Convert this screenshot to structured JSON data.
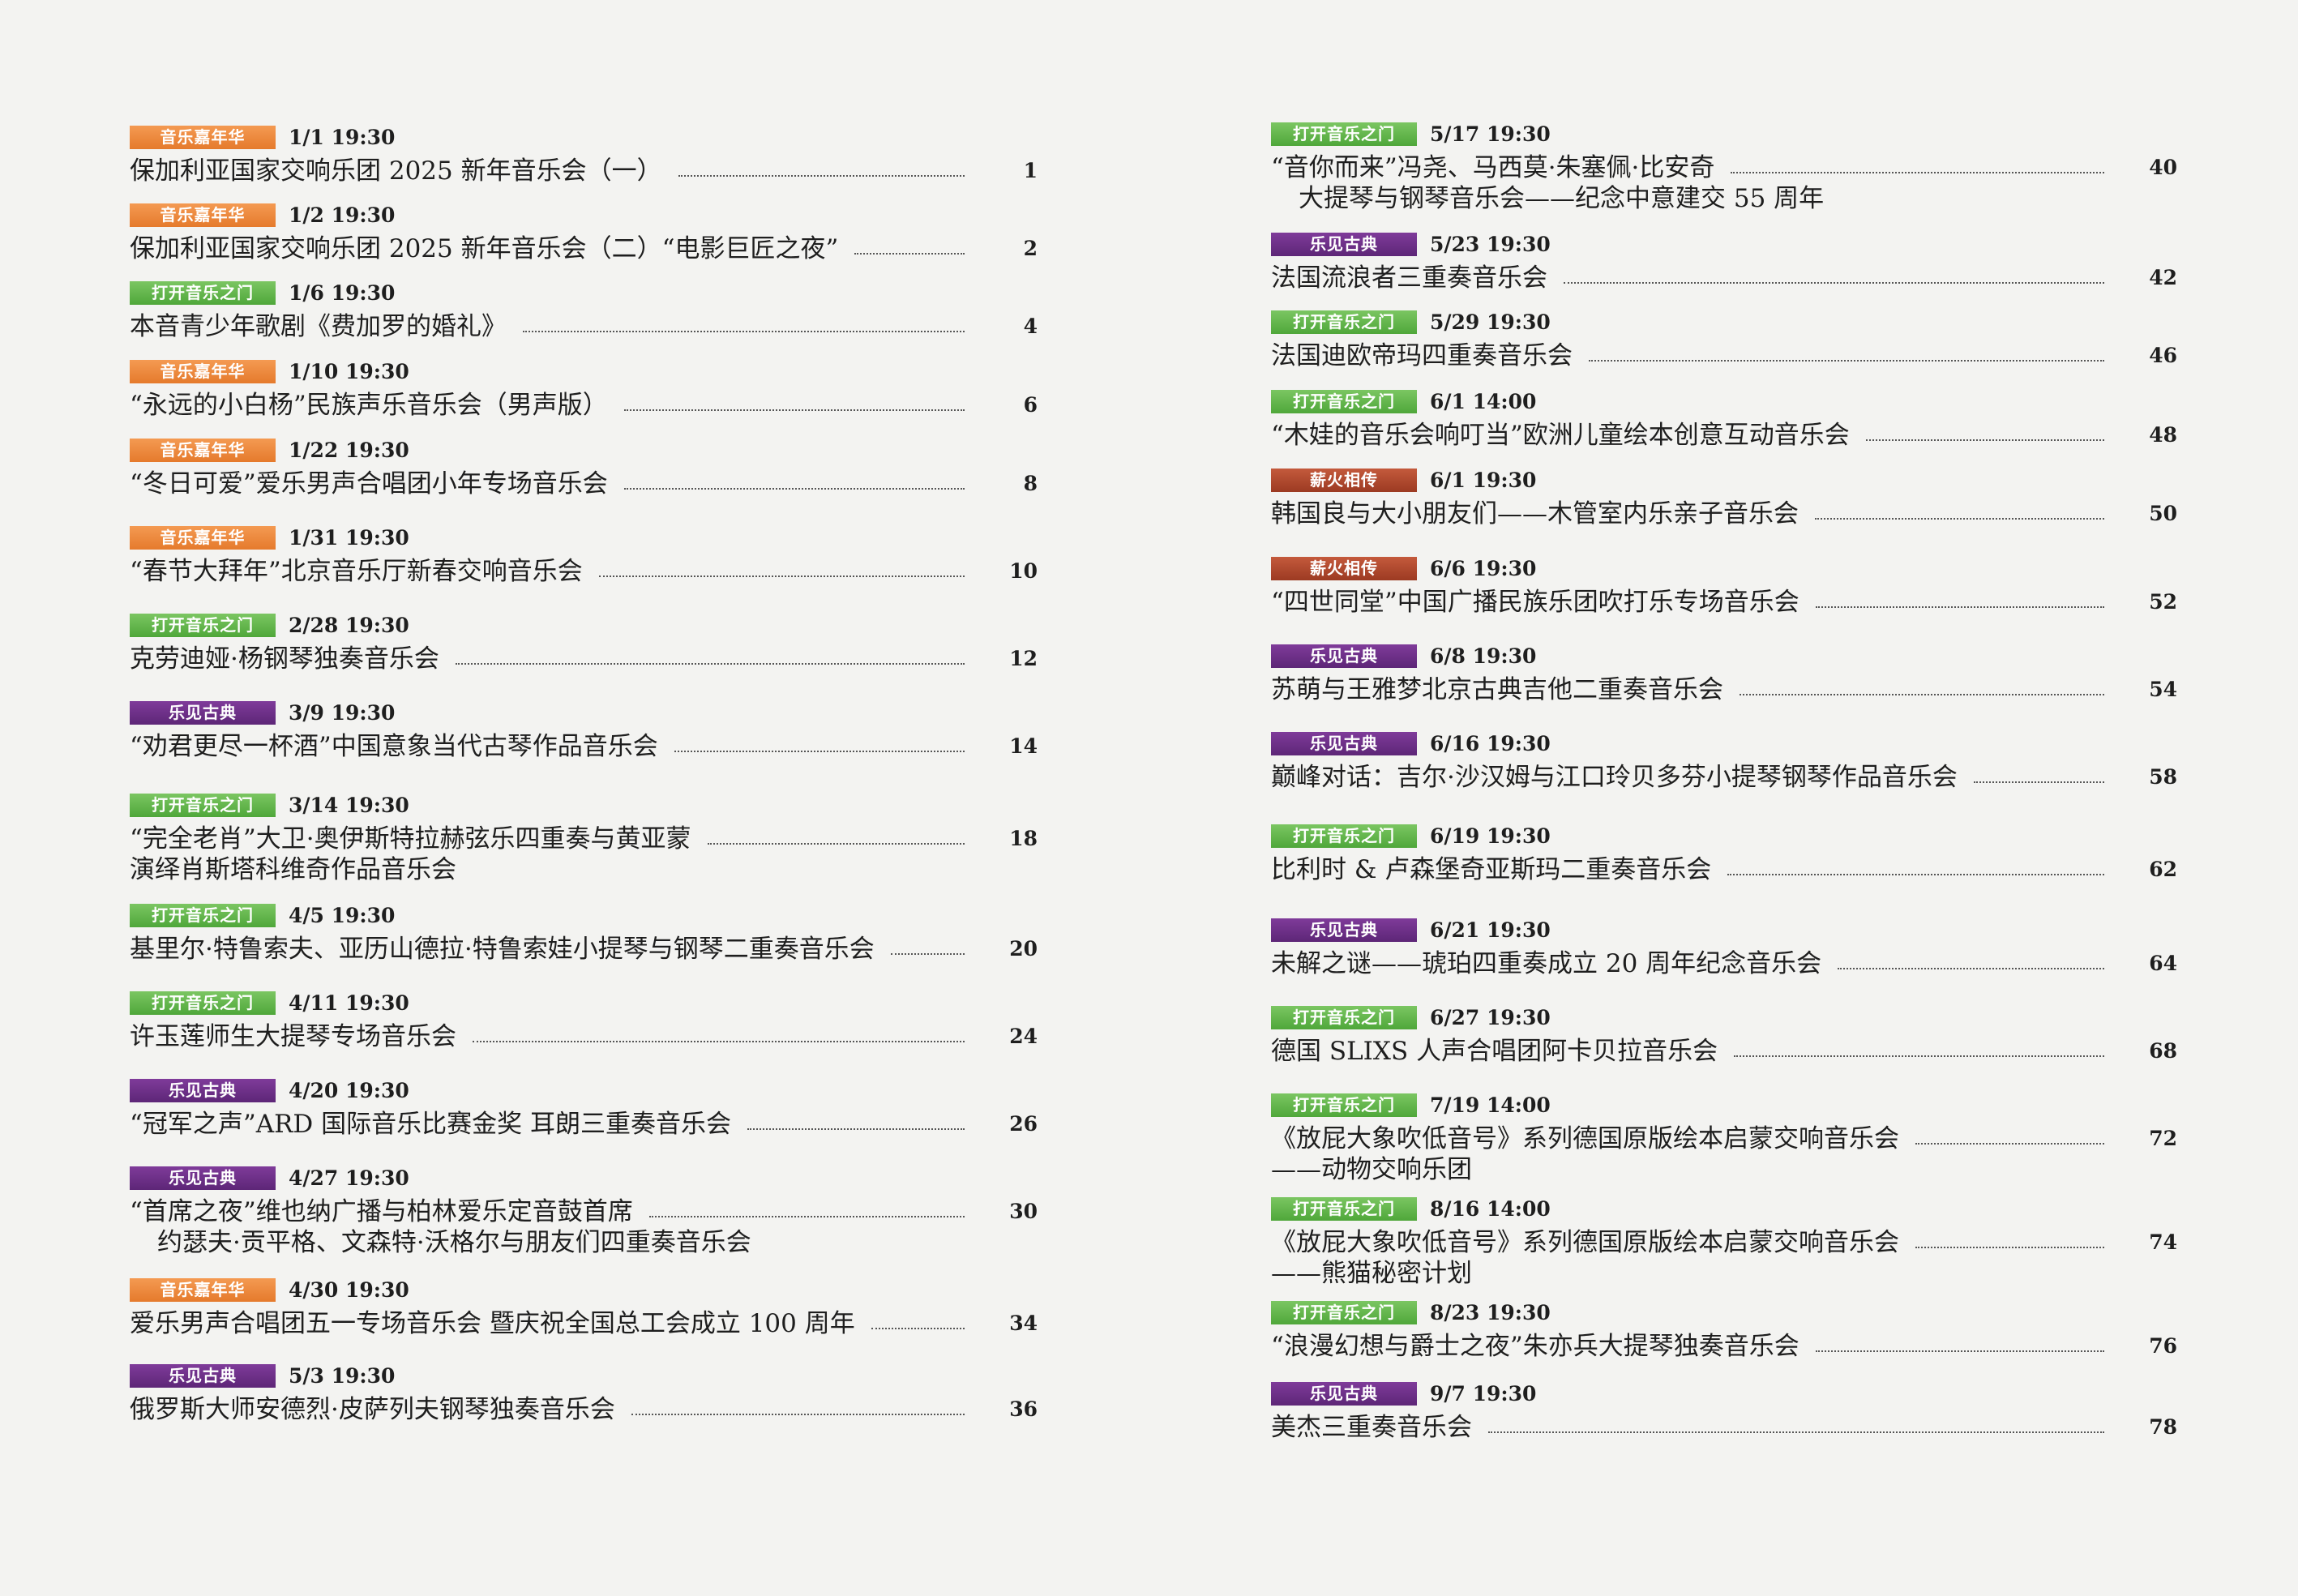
{
  "tags": {
    "music_carnival": "音乐嘉年华",
    "open_door": "打开音乐之门",
    "classics": "乐见古典",
    "heritage": "薪火相传"
  },
  "tag_colors": {
    "orange": "#e57a2c",
    "green": "#4fa73a",
    "purple": "#5d2677",
    "red": "#9c3a22"
  },
  "left": [
    {
      "tag": "音乐嘉年华",
      "date": "1/1 19:30",
      "title": "保加利亚国家交响乐团 2025 新年音乐会（一）",
      "page": "1"
    },
    {
      "tag": "音乐嘉年华",
      "date": "1/2 19:30",
      "title": "保加利亚国家交响乐团 2025 新年音乐会（二）“电影巨匠之夜”",
      "page": "2"
    },
    {
      "tag": "打开音乐之门",
      "date": "1/6 19:30",
      "title": "本音青少年歌剧《费加罗的婚礼》",
      "page": "4"
    },
    {
      "tag": "音乐嘉年华",
      "date": "1/10 19:30",
      "title": "“永远的小白杨”民族声乐音乐会（男声版）",
      "page": "6"
    },
    {
      "tag": "音乐嘉年华",
      "date": "1/22 19:30",
      "title": "“冬日可爱”爱乐男声合唱团小年专场音乐会",
      "page": "8"
    },
    {
      "tag": "音乐嘉年华",
      "date": "1/31 19:30",
      "title": "“春节大拜年”北京音乐厅新春交响音乐会",
      "page": "10"
    },
    {
      "tag": "打开音乐之门",
      "date": "2/28 19:30",
      "title": "克劳迪娅·杨钢琴独奏音乐会",
      "page": "12"
    },
    {
      "tag": "乐见古典",
      "date": "3/9 19:30",
      "title": "“劝君更尽一杯酒”中国意象当代古琴作品音乐会",
      "page": "14"
    },
    {
      "tag": "打开音乐之门",
      "date": "3/14 19:30",
      "title": "“完全老肖”大卫·奥伊斯特拉赫弦乐四重奏与黄亚蒙",
      "title2": "演绎肖斯塔科维奇作品音乐会",
      "page": "18"
    },
    {
      "tag": "打开音乐之门",
      "date": "4/5 19:30",
      "title": "基里尔·特鲁索夫、亚历山德拉·特鲁索娃小提琴与钢琴二重奏音乐会",
      "page": "20"
    },
    {
      "tag": "打开音乐之门",
      "date": "4/11 19:30",
      "title": "许玉莲师生大提琴专场音乐会",
      "page": "24"
    },
    {
      "tag": "乐见古典",
      "date": "4/20 19:30",
      "title": "“冠军之声”ARD 国际音乐比赛金奖 耳朗三重奏音乐会",
      "page": "26"
    },
    {
      "tag": "乐见古典",
      "date": "4/27 19:30",
      "title": "“首席之夜”维也纳广播与柏林爱乐定音鼓首席",
      "title2": "约瑟夫·贡平格、文森特·沃格尔与朋友们四重奏音乐会",
      "page": "30"
    },
    {
      "tag": "音乐嘉年华",
      "date": "4/30 19:30",
      "title": "爱乐男声合唱团五一专场音乐会 暨庆祝全国总工会成立 100 周年",
      "page": "34"
    },
    {
      "tag": "乐见古典",
      "date": "5/3 19:30",
      "title": "俄罗斯大师安德烈·皮萨列夫钢琴独奏音乐会",
      "page": "36"
    }
  ],
  "right": [
    {
      "tag": "打开音乐之门",
      "date": "5/17 19:30",
      "title": "“音你而来”冯尧、马西莫·朱塞佩·比安奇",
      "title2": "大提琴与钢琴音乐会——纪念中意建交 55 周年",
      "page": "40"
    },
    {
      "tag": "乐见古典",
      "date": "5/23 19:30",
      "title": "法国流浪者三重奏音乐会",
      "page": "42"
    },
    {
      "tag": "打开音乐之门",
      "date": "5/29 19:30",
      "title": "法国迪欧帝玛四重奏音乐会",
      "page": "46"
    },
    {
      "tag": "打开音乐之门",
      "date": "6/1 14:00",
      "title": "“木娃的音乐会响叮当”欧洲儿童绘本创意互动音乐会",
      "page": "48"
    },
    {
      "tag": "薪火相传",
      "date": "6/1 19:30",
      "title": "韩国良与大小朋友们——木管室内乐亲子音乐会",
      "page": "50"
    },
    {
      "tag": "薪火相传",
      "date": "6/6 19:30",
      "title": "“四世同堂”中国广播民族乐团吹打乐专场音乐会",
      "page": "52"
    },
    {
      "tag": "乐见古典",
      "date": "6/8 19:30",
      "title": "苏萌与王雅梦北京古典吉他二重奏音乐会",
      "page": "54"
    },
    {
      "tag": "乐见古典",
      "date": "6/16 19:30",
      "title": "巅峰对话：吉尔·沙汉姆与江口玲贝多芬小提琴钢琴作品音乐会",
      "page": "58"
    },
    {
      "tag": "打开音乐之门",
      "date": "6/19 19:30",
      "title": "比利时 & 卢森堡奇亚斯玛二重奏音乐会",
      "page": "62"
    },
    {
      "tag": "乐见古典",
      "date": "6/21 19:30",
      "title": "未解之谜——琥珀四重奏成立 20 周年纪念音乐会",
      "page": "64"
    },
    {
      "tag": "打开音乐之门",
      "date": "6/27 19:30",
      "title": "德国 SLIXS 人声合唱团阿卡贝拉音乐会",
      "page": "68"
    },
    {
      "tag": "打开音乐之门",
      "date": "7/19 14:00",
      "title": "《放屁大象吹低音号》系列德国原版绘本启蒙交响音乐会",
      "title2": "——动物交响乐团",
      "page": "72"
    },
    {
      "tag": "打开音乐之门",
      "date": "8/16 14:00",
      "title": "《放屁大象吹低音号》系列德国原版绘本启蒙交响音乐会",
      "title2": "——熊猫秘密计划",
      "page": "74"
    },
    {
      "tag": "打开音乐之门",
      "date": "8/23 19:30",
      "title": "“浪漫幻想与爵士之夜”朱亦兵大提琴独奏音乐会",
      "page": "76"
    },
    {
      "tag": "乐见古典",
      "date": "9/7 19:30",
      "title": "美杰三重奏音乐会",
      "page": "78"
    }
  ]
}
